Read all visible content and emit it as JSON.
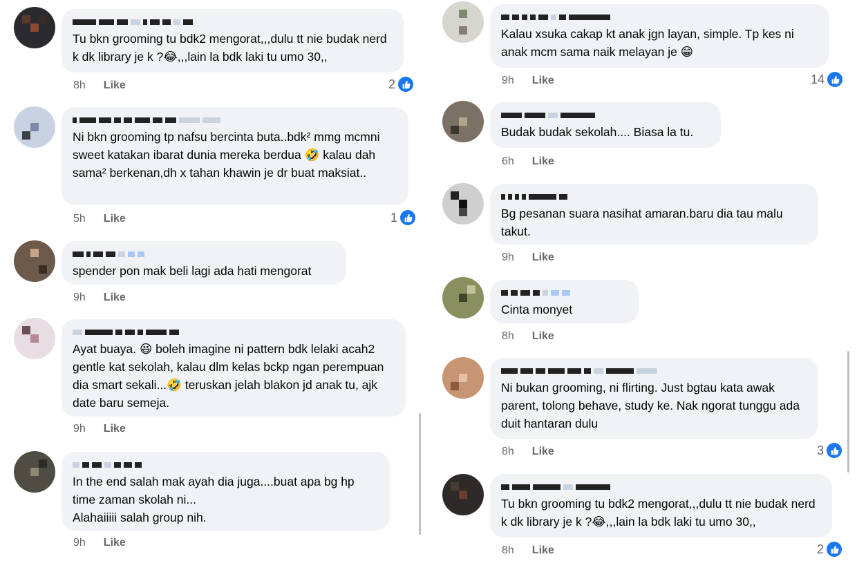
{
  "colors": {
    "bubble": "#f0f2f5",
    "accent": "#1877f2",
    "meta": "#65676b"
  },
  "left": [
    {
      "text": "Tu bkn grooming tu bdk2 mengorat,,,dulu tt nie budak nerd k dk library je k  ?😂,,,lain la bdk laki tu umo 30,,",
      "time": "8h",
      "like": "Like",
      "reactions": "2"
    },
    {
      "text": "Ni bkn grooming tp nafsu bercinta buta..bdk² mmg mcmni sweet katakan ibarat dunia mereka berdua 🤣 kalau dah sama² berkenan,dh x tahan khawin je dr buat maksiat..",
      "time": "5h",
      "like": "Like",
      "reactions": "1"
    },
    {
      "text": "spender pon mak beli lagi ada hati mengorat",
      "time": "9h",
      "like": "Like",
      "reactions": ""
    },
    {
      "text": "Ayat buaya. 😆 boleh imagine ni pattern bdk lelaki acah2 gentle kat sekolah, kalau dlm kelas bckp ngan perempuan dia smart sekali...🤣 teruskan jelah blakon jd anak tu, ajk date baru semeja.",
      "time": "9h",
      "like": "Like",
      "reactions": ""
    },
    {
      "text": "In the end salah mak ayah dia juga....buat apa bg hp time zaman skolah ni...\nAlahaiiiii salah group nih.",
      "time": "9h",
      "like": "Like",
      "reactions": ""
    }
  ],
  "right": [
    {
      "text": "Kalau xsuka cakap kt anak jgn layan, simple. Tp kes ni anak mcm sama naik melayan je 😁",
      "time": "9h",
      "like": "Like",
      "reactions": "14"
    },
    {
      "text": "Budak budak sekolah.... Biasa la tu.",
      "time": "6h",
      "like": "Like",
      "reactions": ""
    },
    {
      "text": "Bg pesanan suara nasihat amaran.baru dia tau malu takut.",
      "time": "9h",
      "like": "Like",
      "reactions": ""
    },
    {
      "text": "Cinta monyet",
      "time": "8h",
      "like": "Like",
      "reactions": ""
    },
    {
      "text": "Ni bukan grooming, ni flirting. Just bgtau kata awak parent, tolong behave, study ke. Nak ngorat tunggu ada duit hantaran dulu",
      "time": "8h",
      "like": "Like",
      "reactions": "3"
    },
    {
      "text": "Tu bkn grooming tu bdk2 mengorat,,,dulu tt nie budak nerd k dk library je k  ?😂,,,lain la bdk laki tu umo 30,,",
      "time": "8h",
      "like": "Like",
      "reactions": "2"
    }
  ]
}
